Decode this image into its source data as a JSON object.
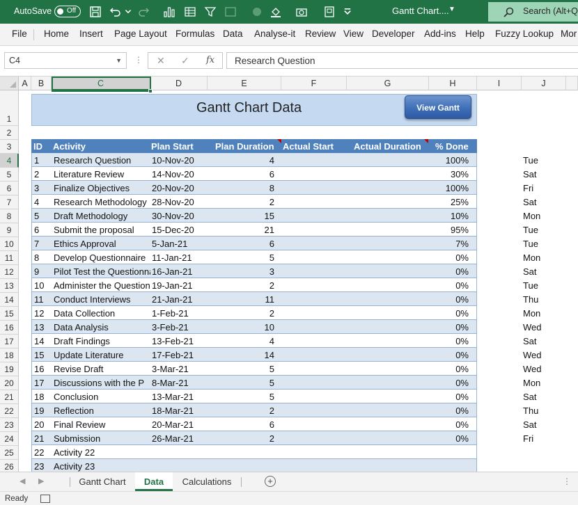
{
  "titlebar": {
    "autosave_label": "AutoSave",
    "autosave_state": "Off",
    "file_title": "Gantt Chart....",
    "search_placeholder": "Search (Alt+Q)"
  },
  "menu": [
    "File",
    "Home",
    "Insert",
    "Page Layout",
    "Formulas",
    "Data",
    "Analyse-it",
    "Review",
    "View",
    "Developer",
    "Add-ins",
    "Help",
    "Fuzzy Lookup",
    "Mor"
  ],
  "formula_bar": {
    "name_box": "C4",
    "fx": "fx",
    "content": "Research Question"
  },
  "columns": [
    "A",
    "B",
    "C",
    "D",
    "E",
    "F",
    "G",
    "H",
    "I",
    "J"
  ],
  "rows": [
    "1",
    "2",
    "3",
    "4",
    "5",
    "6",
    "7",
    "8",
    "9",
    "10",
    "11",
    "12",
    "13",
    "14",
    "15",
    "16",
    "17",
    "18",
    "19",
    "20",
    "21",
    "22",
    "23",
    "24",
    "25",
    "26"
  ],
  "sheet": {
    "title": "Gantt Chart Data",
    "view_button": "View Gantt",
    "headers": {
      "id": "ID",
      "activity": "Activity",
      "plan_start": "Plan Start",
      "plan_duration": "Plan Duration",
      "actual_start": "Actual Start",
      "actual_duration": "Actual Duration",
      "pct_done": "% Done"
    },
    "tasks": [
      {
        "id": "1",
        "activity": "Research Question",
        "start": "10-Nov-20",
        "duration": "4",
        "pct": "100%",
        "day": "Tue"
      },
      {
        "id": "2",
        "activity": "Literature Review",
        "start": "14-Nov-20",
        "duration": "6",
        "pct": "30%",
        "day": "Sat"
      },
      {
        "id": "3",
        "activity": "Finalize Objectives",
        "start": "20-Nov-20",
        "duration": "8",
        "pct": "100%",
        "day": "Fri"
      },
      {
        "id": "4",
        "activity": "Research Methodology",
        "start": "28-Nov-20",
        "duration": "2",
        "pct": "25%",
        "day": "Sat"
      },
      {
        "id": "5",
        "activity": "Draft Methodology",
        "start": "30-Nov-20",
        "duration": "15",
        "pct": "10%",
        "day": "Mon"
      },
      {
        "id": "6",
        "activity": "Submit the proposal",
        "start": "15-Dec-20",
        "duration": "21",
        "pct": "95%",
        "day": "Tue"
      },
      {
        "id": "7",
        "activity": "Ethics Approval",
        "start": "5-Jan-21",
        "duration": "6",
        "pct": "7%",
        "day": "Tue"
      },
      {
        "id": "8",
        "activity": "Develop Questionnaire",
        "start": "11-Jan-21",
        "duration": "5",
        "pct": "0%",
        "day": "Mon"
      },
      {
        "id": "9",
        "activity": "Pilot Test the Questionnaire",
        "start": "16-Jan-21",
        "duration": "3",
        "pct": "0%",
        "day": "Sat"
      },
      {
        "id": "10",
        "activity": "Administer the Questionnaire",
        "start": "19-Jan-21",
        "duration": "2",
        "pct": "0%",
        "day": "Tue"
      },
      {
        "id": "11",
        "activity": "Conduct Interviews",
        "start": "21-Jan-21",
        "duration": "11",
        "pct": "0%",
        "day": "Thu"
      },
      {
        "id": "12",
        "activity": "Data Collection",
        "start": "1-Feb-21",
        "duration": "2",
        "pct": "0%",
        "day": "Mon"
      },
      {
        "id": "13",
        "activity": "Data Analysis",
        "start": "3-Feb-21",
        "duration": "10",
        "pct": "0%",
        "day": "Wed"
      },
      {
        "id": "14",
        "activity": "Draft Findings",
        "start": "13-Feb-21",
        "duration": "4",
        "pct": "0%",
        "day": "Sat"
      },
      {
        "id": "15",
        "activity": "Update Literature",
        "start": "17-Feb-21",
        "duration": "14",
        "pct": "0%",
        "day": "Wed"
      },
      {
        "id": "16",
        "activity": "Revise Draft",
        "start": "3-Mar-21",
        "duration": "5",
        "pct": "0%",
        "day": "Wed"
      },
      {
        "id": "17",
        "activity": "Discussions with the P",
        "start": "8-Mar-21",
        "duration": "5",
        "pct": "0%",
        "day": "Mon"
      },
      {
        "id": "18",
        "activity": "Conclusion",
        "start": "13-Mar-21",
        "duration": "5",
        "pct": "0%",
        "day": "Sat"
      },
      {
        "id": "19",
        "activity": "Reflection",
        "start": "18-Mar-21",
        "duration": "2",
        "pct": "0%",
        "day": "Thu"
      },
      {
        "id": "20",
        "activity": "Final Review",
        "start": "20-Mar-21",
        "duration": "6",
        "pct": "0%",
        "day": "Sat"
      },
      {
        "id": "21",
        "activity": "Submission",
        "start": "26-Mar-21",
        "duration": "2",
        "pct": "0%",
        "day": "Fri"
      },
      {
        "id": "22",
        "activity": "Activity 22",
        "start": "",
        "duration": "",
        "pct": "",
        "day": ""
      },
      {
        "id": "23",
        "activity": "Activity 23",
        "start": "",
        "duration": "",
        "pct": "",
        "day": ""
      }
    ]
  },
  "sheet_tabs": [
    {
      "label": "Gantt Chart",
      "active": false
    },
    {
      "label": "Data",
      "active": true
    },
    {
      "label": "Calculations",
      "active": false
    }
  ],
  "status": {
    "text": "Ready"
  }
}
